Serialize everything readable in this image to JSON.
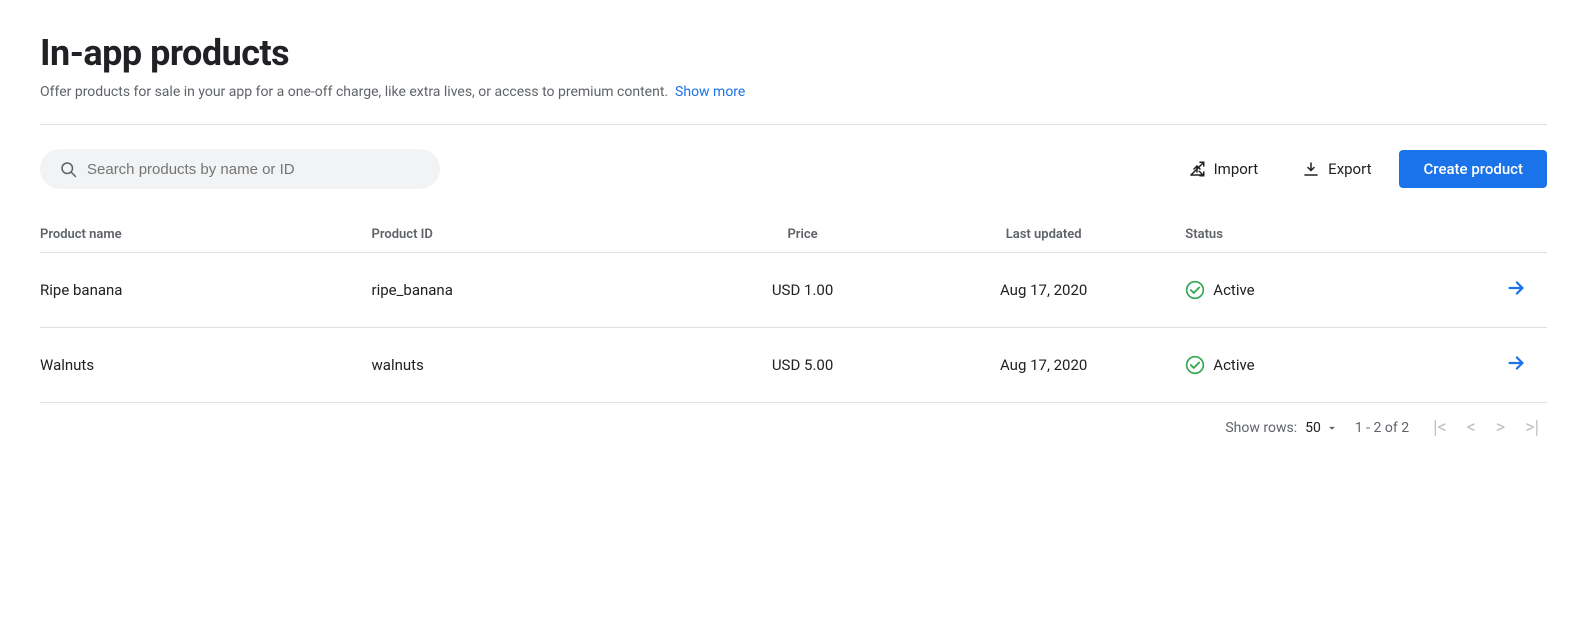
{
  "page": {
    "title": "In-app products",
    "subtitle": "Offer products for sale in your app for a one-off charge, like extra lives, or access to premium content.",
    "show_more_label": "Show more"
  },
  "toolbar": {
    "search_placeholder": "Search products by name or ID",
    "import_label": "Import",
    "export_label": "Export",
    "create_label": "Create product"
  },
  "table": {
    "columns": [
      {
        "key": "name",
        "label": "Product name"
      },
      {
        "key": "id",
        "label": "Product ID"
      },
      {
        "key": "price",
        "label": "Price"
      },
      {
        "key": "updated",
        "label": "Last updated"
      },
      {
        "key": "status",
        "label": "Status"
      }
    ],
    "rows": [
      {
        "name": "Ripe banana",
        "product_id": "ripe_banana",
        "price": "USD 1.00",
        "updated": "Aug 17, 2020",
        "status": "Active"
      },
      {
        "name": "Walnuts",
        "product_id": "walnuts",
        "price": "USD 5.00",
        "updated": "Aug 17, 2020",
        "status": "Active"
      }
    ]
  },
  "footer": {
    "show_rows_label": "Show rows:",
    "rows_value": "50",
    "pagination_info": "1 - 2 of 2"
  }
}
